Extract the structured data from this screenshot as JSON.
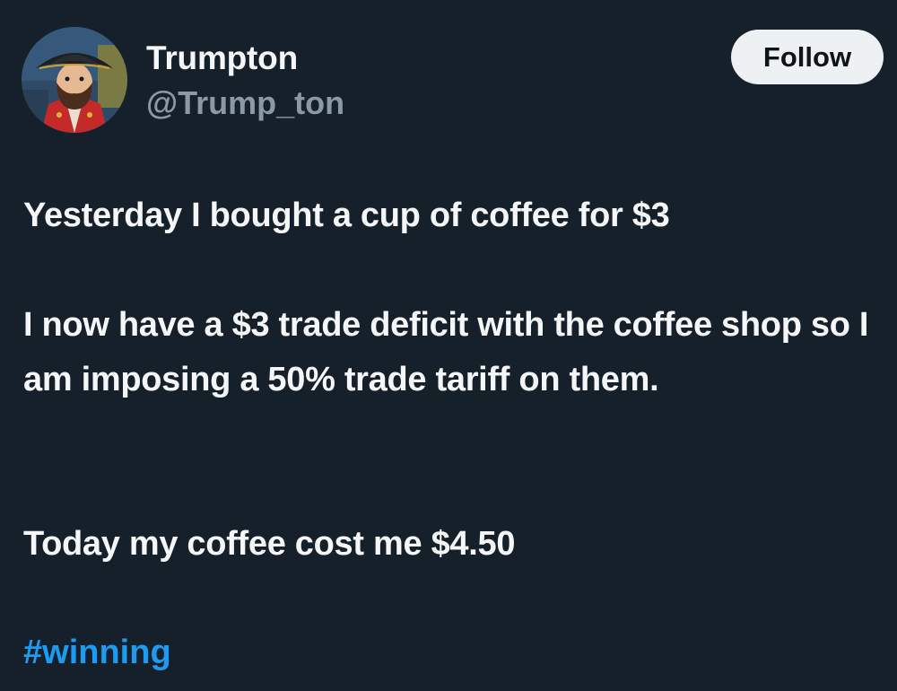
{
  "author": {
    "display_name": "Trumpton",
    "handle": "@Trump_ton",
    "avatar": "pirate-captain-avatar"
  },
  "follow_button": {
    "label": "Follow"
  },
  "tweet": {
    "paragraph_1": "Yesterday I bought a cup of coffee for $3",
    "paragraph_2": "I now have a $3 trade deficit with the coffee shop so I am imposing a 50% trade tariff on them.",
    "paragraph_3": "Today my coffee cost me $4.50",
    "hashtag": "#winning"
  },
  "colors": {
    "background": "#16202b",
    "text": "#f4f6f8",
    "handle": "#8b98a5",
    "hashtag": "#1d9bf0",
    "button_bg": "#eef1f3"
  }
}
